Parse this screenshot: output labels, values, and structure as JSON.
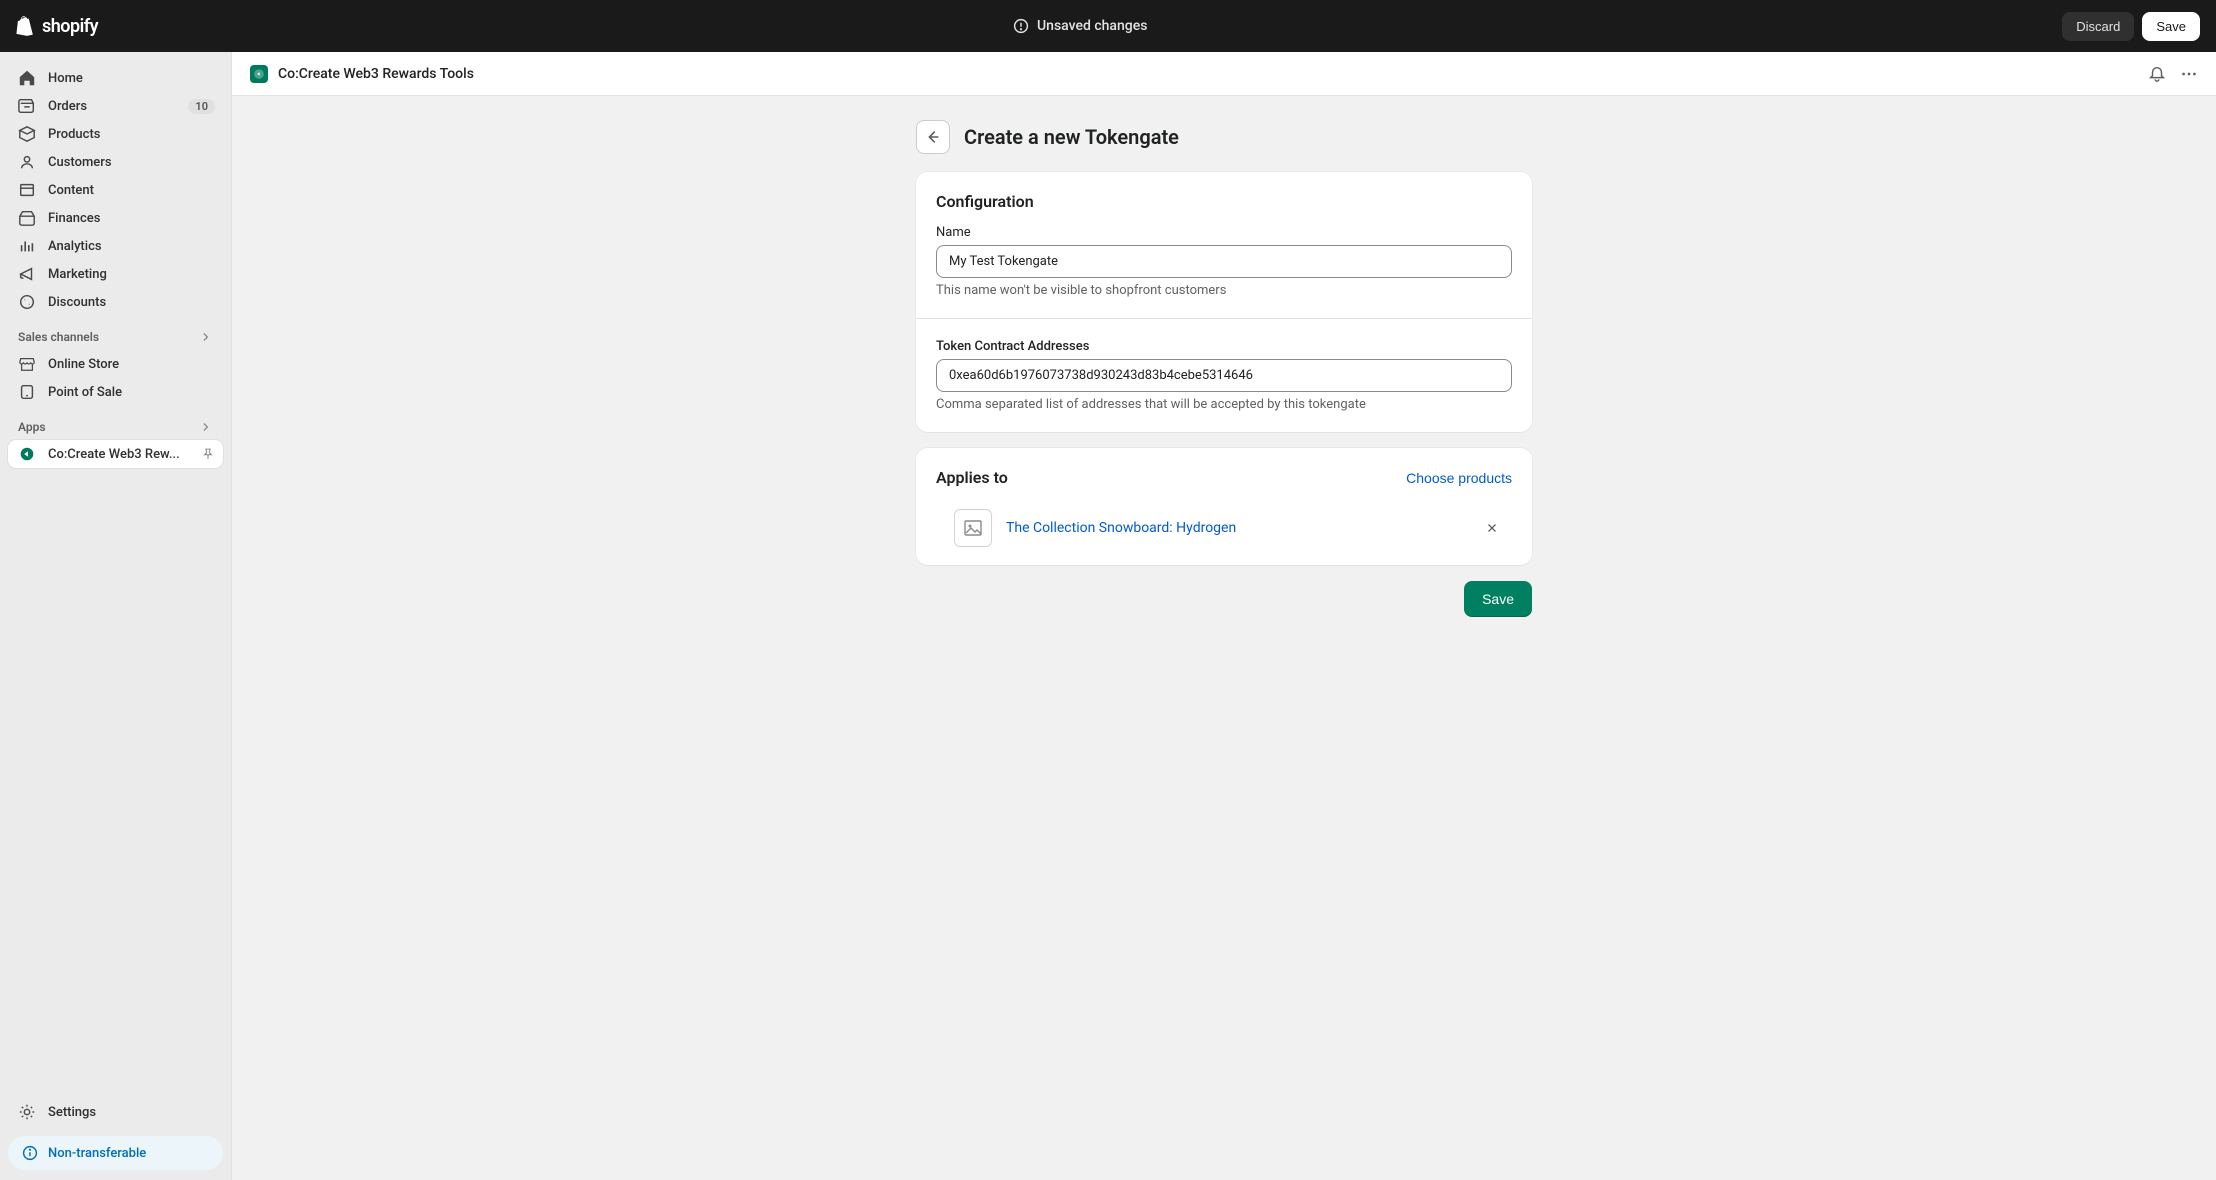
{
  "topbar": {
    "brand": "shopify",
    "unsaved_msg": "Unsaved changes",
    "discard_label": "Discard",
    "save_label": "Save"
  },
  "sidebar": {
    "items": [
      {
        "label": "Home"
      },
      {
        "label": "Orders",
        "badge": "10"
      },
      {
        "label": "Products"
      },
      {
        "label": "Customers"
      },
      {
        "label": "Content"
      },
      {
        "label": "Finances"
      },
      {
        "label": "Analytics"
      },
      {
        "label": "Marketing"
      },
      {
        "label": "Discounts"
      }
    ],
    "sales_header": "Sales channels",
    "sales": [
      {
        "label": "Online Store"
      },
      {
        "label": "Point of Sale"
      }
    ],
    "apps_header": "Apps",
    "apps": [
      {
        "label": "Co:Create Web3 Rew..."
      }
    ],
    "settings_label": "Settings",
    "pill_label": "Non-transferable"
  },
  "app_header": {
    "title": "Co:Create Web3 Rewards Tools"
  },
  "page": {
    "title": "Create a new Tokengate",
    "config_heading": "Configuration",
    "name_label": "Name",
    "name_value": "My Test Tokengate",
    "name_help": "This name won't be visible to shopfront customers",
    "token_label": "Token Contract Addresses",
    "token_value": "0xea60d6b1976073738d930243d83b4cebe5314646",
    "token_help": "Comma separated list of addresses that will be accepted by this tokengate",
    "applies_heading": "Applies to",
    "choose_label": "Choose products",
    "products": [
      {
        "name": "The Collection Snowboard: Hydrogen"
      }
    ],
    "save_label": "Save"
  }
}
